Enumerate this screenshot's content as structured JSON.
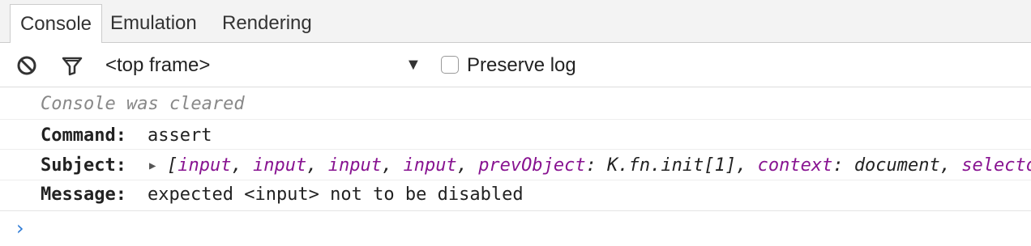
{
  "tabs": [
    {
      "label": "Console",
      "active": true
    },
    {
      "label": "Emulation",
      "active": false
    },
    {
      "label": "Rendering",
      "active": false
    }
  ],
  "toolbar": {
    "clear_icon": "block-icon",
    "filter_icon": "funnel-icon",
    "frame_selector": "<top frame>",
    "frame_arrow": "▼",
    "preserve_log_label": "Preserve log",
    "preserve_log_checked": false
  },
  "console": {
    "cleared_message": "Console was cleared",
    "command_key": "Command:",
    "command_value": "assert",
    "subject_key": "Subject:",
    "subject_tokens": {
      "open": "[",
      "items": [
        "input",
        "input",
        "input",
        "input"
      ],
      "prev_key": "prevObject",
      "prev_value": "K.fn.init[1]",
      "context_key": "context",
      "context_value": "document",
      "selector_key": "selecto"
    },
    "message_key": "Message:",
    "message_value": "expected <input> not to be disabled",
    "prompt_glyph": "›"
  },
  "colors": {
    "prompt": "#2e7bd6",
    "property_name": "#881391",
    "cleared_text": "#888888"
  }
}
